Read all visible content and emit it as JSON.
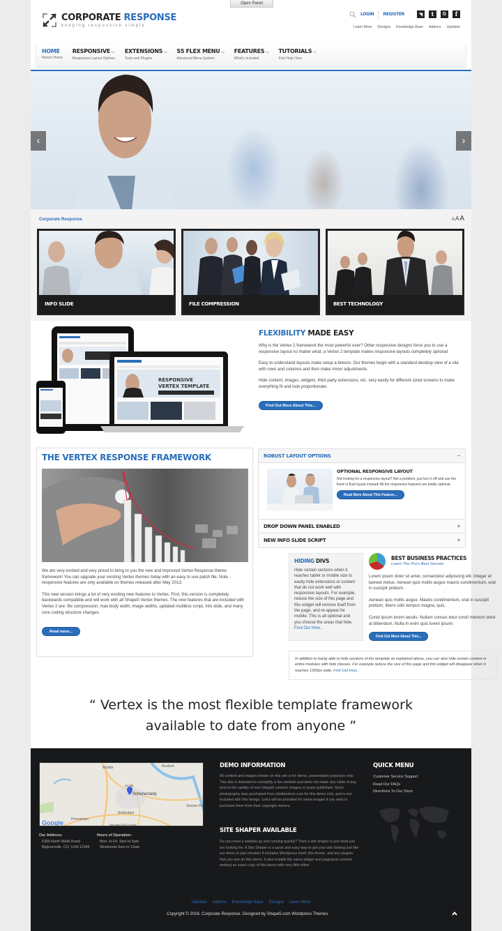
{
  "panel": {
    "open_label": "Open Panel"
  },
  "header": {
    "logo_word1": "CORPORATE",
    "logo_word2": "RESPONSE",
    "tagline": "keeping responsive simple",
    "login": "LOGIN",
    "register": "REGISTER",
    "social": [
      {
        "name": "rss-icon",
        "glyph": "◥"
      },
      {
        "name": "tumblr-icon",
        "glyph": "t"
      },
      {
        "name": "google-icon",
        "glyph": "G"
      },
      {
        "name": "facebook-icon",
        "glyph": "f"
      }
    ],
    "toplinks": [
      "Learn More",
      "Designs",
      "Knowledge Base",
      "Addons",
      "Updates"
    ]
  },
  "menu": [
    {
      "title": "HOME",
      "sub": "Return Home",
      "dropdown": false,
      "active": true
    },
    {
      "title": "RESPONSIVE",
      "sub": "Responsive Layout Options",
      "dropdown": true
    },
    {
      "title": "EXTENSIONS",
      "sub": "Tools and Plugins",
      "dropdown": true
    },
    {
      "title": "S5 FLEX MENU",
      "sub": "Advanced Menu System",
      "dropdown": true
    },
    {
      "title": "FEATURES",
      "sub": "What's Included",
      "dropdown": true
    },
    {
      "title": "TUTORIALS",
      "sub": "Find Help Here",
      "dropdown": true
    }
  ],
  "hero": {
    "prev": "‹",
    "next": "›"
  },
  "breadcrumb": "Corporate Response",
  "font_sizes": [
    "A",
    "A",
    "A"
  ],
  "tiles": [
    "INFO SLIDE",
    "FILE COMPRESSION",
    "BEST TECHNOLOGY"
  ],
  "flexibility": {
    "title_blue": "FLEXIBILITY",
    "title_rest": " MADE EASY",
    "paragraphs": [
      "Why is the Vertex 2 framework the most powerful ever? Other responsive designs force you to use a responsive layout no matter what, a Vertex 2 template makes responsive layouts completely optional.",
      "Easy to understand layouts make setup a breeze. Our themes begin with a standard desktop view of a site with rows and columns and then make minor adjustments.",
      "Hide content, images, widgets, third party extensions, etc. very easily for different sized screens to make everything fit and look proportionate."
    ],
    "button": "Find Out More About This..."
  },
  "device_mockup": {
    "headline": "RESPONSIVE VERTEX TEMPLATE"
  },
  "vertex": {
    "title": "THE VERTEX RESPONSE FRAMEWORK",
    "paragraphs": [
      "We are very excited and very proud to bring to you the new and improved Vertex Response theme framework! You can upgrade your existing Vertex themes today with an easy to use patch file. Note - responsive features are only available on themes released after May 2013.",
      "This new version brings a lot of very exciting new features to Vertex. First, this version is completely backwards compatible and will work with all Shape5 Vertex themes. The new features that are included with Vertex 2 are: file compression, max body width, image widths, updated multibox script, info slide, and many core coding structure changes."
    ],
    "button": "Read more..."
  },
  "accordion": [
    {
      "title": "ROBUST LAYOUT OPTIONS",
      "open": true,
      "toggle": "−",
      "content_title": "OPTIONAL RESPONSIVE LAYOUT",
      "content_text": "Not looking for a responsive layout? Not a problem, just turn it off and use the fixed or fluid layout instead! All the responsive features are totally optional.",
      "button": "Read More About This Feature..."
    },
    {
      "title": "DROP DOWN PANEL ENABLED",
      "open": false,
      "toggle": "+"
    },
    {
      "title": "NEW INFO SLIDE SCRIPT",
      "open": false,
      "toggle": "+"
    }
  ],
  "hiding": {
    "title_blue": "HIDING",
    "title_rest": " DIVS",
    "text": "Hide certain sections when it reaches tablet or mobile size to easily hide extensions or content that do not work well with responsive layouts. For example, reduce the size of this page and this widget will remove itself from the page, and re-appear for mobile. This is all optional and you choose the areas that hide.",
    "link": "Find Out How..."
  },
  "best": {
    "title": "BEST BUSINESS PRACTICES",
    "subtitle": "Learn The Pro's Best Secrets",
    "paragraphs": [
      "Lorem ipsum dolor sit amet, consectetur adipiscing elit. Integer et laoreet metus. Aenean quis mollis augue mauris condimentum, erat in suscipit pretium.",
      "Aenean quis mollis augue. Mauris condimentum, erat in suscipit pretium, libero odio tempus magna, quis.",
      "Condi ipsum lorem iaculis. Nullam consec tetur condi mentum dolor at bibendum. Nulla in enim quis lorem ipsum."
    ],
    "button": "Find Out More About This..."
  },
  "note": {
    "text": "In addition to being able to hide sections of the template as explained above, you can also hide certain content or entire modules with hide classes. For example reduce the size of this page and this widget will disappear when it reaches 1300px wide. ",
    "link": "Find Out How..."
  },
  "quote": {
    "line1": "“ Vertex is the most flexible template framework",
    "line2": "available to date from anyone ”"
  },
  "footer": {
    "map": {
      "labels": [
        "Wyatts",
        "Rexford",
        "Scotia",
        "Schenectady",
        "Rotterdam",
        "Princetown",
        "Vischer Fe"
      ],
      "attribution": "Map data ©2016 Google",
      "brand": "Google"
    },
    "address_label": "Our Address:",
    "address_lines": [
      "6399 North Wells Road",
      "Bigtownville, CO, USA 12345"
    ],
    "hours_label": "Hours of Operation:",
    "hours_lines": [
      "Mon. to Fri. 9am to 5pm",
      "Weekends 9am to 12am"
    ],
    "demo_title": "DEMO INFORMATION",
    "demo_text": "All content and images shown on this site is for demo, presentation purposes only. This site is intended to exemplify a live website and does not make any claim of any kind to the validity of non-Shape5 content, images or posts published. Stock photography was purchased from shutterstock.com for this demo only, and is not included with this design. Links will be provided for some images if you wish to purchase them from their copyright owners.",
    "shaper_title": "SITE SHAPER AVAILABLE",
    "shaper_text": "Do you need a website up and running quickly? Then a site shaper is just what you are looking for. A Site Shaper is a quick and easy way to get your site looking just like our demo in just minutes! It includes Wordpress itself, this theme, and any plugins that you see on this demo. It also installs the same widget and page/post content, making an exact copy of this demo with very little effort.",
    "quick_title": "QUICK MENU",
    "quick_links": [
      "Customer Service Support",
      "Read Our FAQs",
      "Directions To Our Store"
    ],
    "bottom_links": [
      "Updates",
      "Addons",
      "Knowledge Base",
      "Designs",
      "Learn More"
    ],
    "copyright": "Copyright © 2016. Corporate Response. Designed by Shape5.com Wordpress Themes",
    "top_glyph": "˄"
  }
}
